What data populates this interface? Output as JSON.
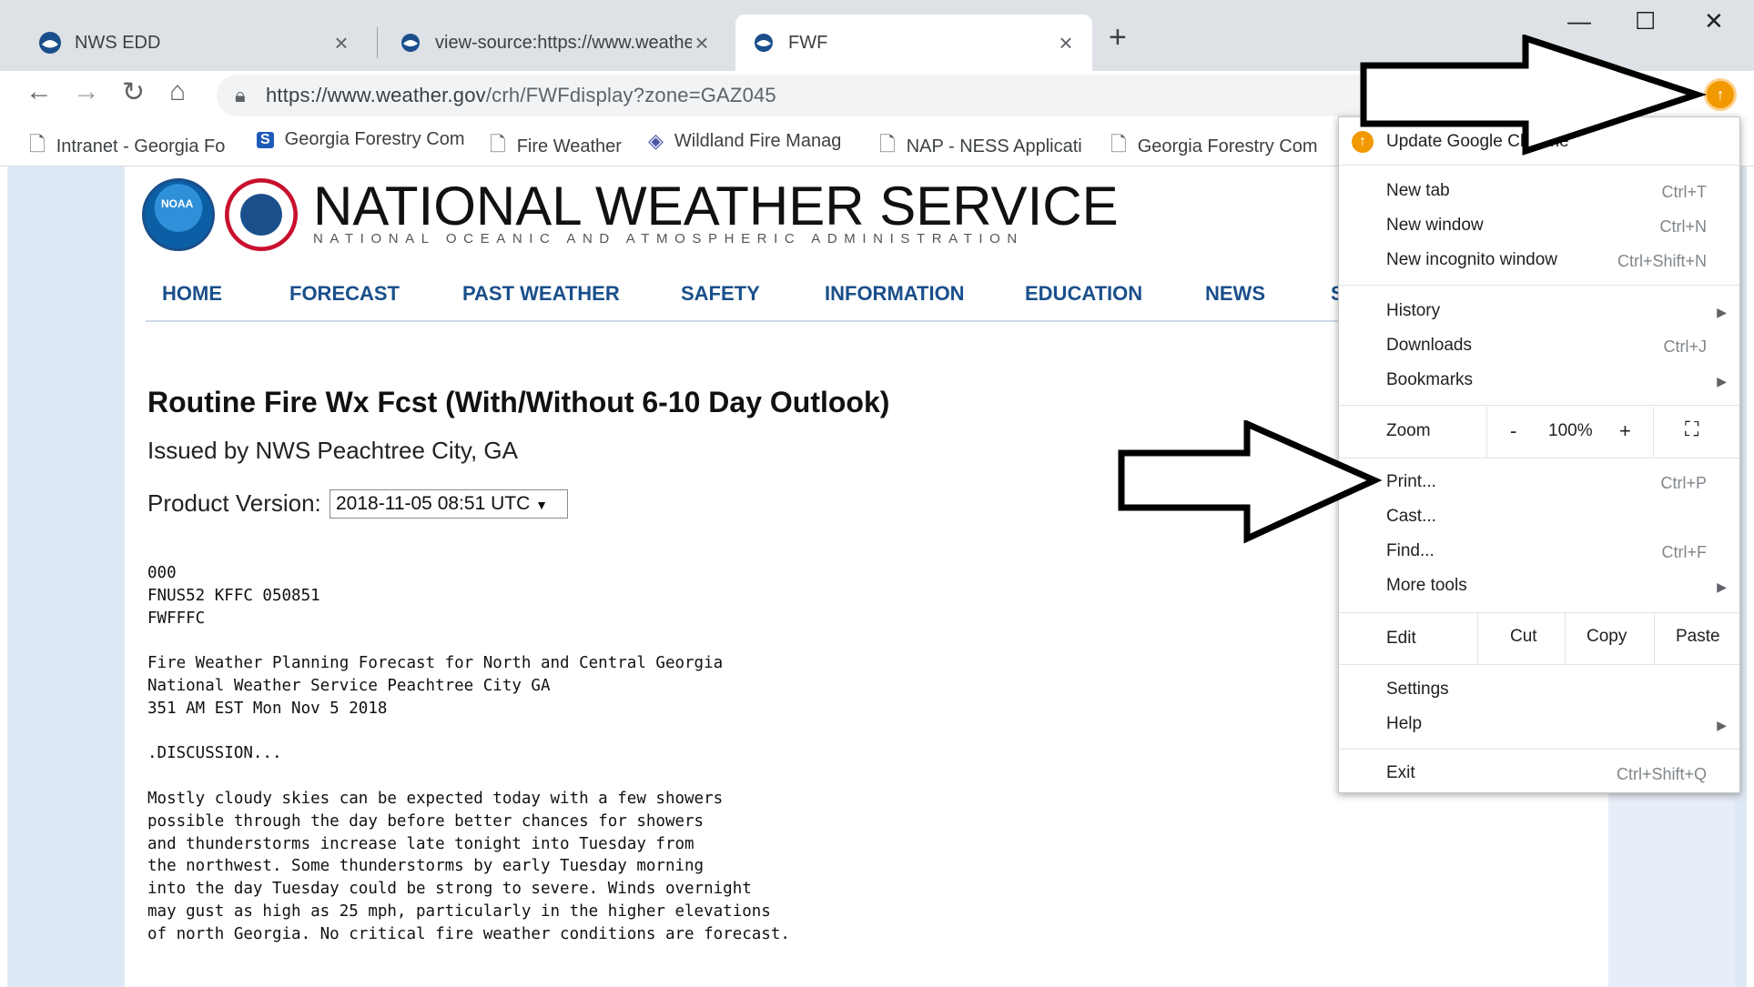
{
  "tabs": [
    {
      "title": "NWS EDD",
      "active": false
    },
    {
      "title": "view-source:https://www.weathe",
      "active": false
    },
    {
      "title": "FWF",
      "active": true
    }
  ],
  "window_controls": {
    "minimize": "—",
    "maximize": "☐",
    "close": "✕"
  },
  "toolbar": {
    "url_host": "https://www.weather.gov",
    "url_path": "/crh/FWFdisplay?zone=GAZ045"
  },
  "bookmarks": [
    {
      "label": "Intranet - Georgia Fo",
      "icon": "page-icon"
    },
    {
      "label": "Georgia Forestry Com",
      "icon": "sharepoint-icon"
    },
    {
      "label": "Fire Weather",
      "icon": "page-icon"
    },
    {
      "label": "Wildland Fire Manag",
      "icon": "diamond-icon"
    },
    {
      "label": "NAP - NESS Applicati",
      "icon": "page-icon"
    },
    {
      "label": "Georgia Forestry Com",
      "icon": "page-icon"
    }
  ],
  "site": {
    "title": "NATIONAL WEATHER SERVICE",
    "subtitle": "NATIONAL OCEANIC AND ATMOSPHERIC ADMINISTRATION",
    "logo_text": "NOAA",
    "nav": [
      "HOME",
      "FORECAST",
      "PAST WEATHER",
      "SAFETY",
      "INFORMATION",
      "EDUCATION",
      "NEWS",
      "S"
    ]
  },
  "product": {
    "heading": "Routine Fire Wx Fcst (With/Without 6-10 Day Outlook)",
    "issued_by": "Issued by NWS Peachtree City, GA",
    "version_label": "Product Version:",
    "version_value": "2018-11-05 08:51 UTC",
    "text": "000\nFNUS52 KFFC 050851\nFWFFFC\n\nFire Weather Planning Forecast for North and Central Georgia\nNational Weather Service Peachtree City GA\n351 AM EST Mon Nov 5 2018\n\n.DISCUSSION...\n\nMostly cloudy skies can be expected today with a few showers\npossible through the day before better chances for showers\nand thunderstorms increase late tonight into Tuesday from\nthe northwest. Some thunderstorms by early Tuesday morning\ninto the day Tuesday could be strong to severe. Winds overnight\nmay gust as high as 25 mph, particularly in the higher elevations\nof north Georgia. No critical fire weather conditions are forecast."
  },
  "menu": {
    "update": "Update Google Chrome",
    "new_tab": "New tab",
    "new_tab_sc": "Ctrl+T",
    "new_window": "New window",
    "new_window_sc": "Ctrl+N",
    "new_incognito": "New incognito window",
    "new_incognito_sc": "Ctrl+Shift+N",
    "history": "History",
    "downloads": "Downloads",
    "downloads_sc": "Ctrl+J",
    "bookmarks": "Bookmarks",
    "zoom": "Zoom",
    "zoom_minus": "-",
    "zoom_value": "100%",
    "zoom_plus": "+",
    "print": "Print...",
    "print_sc": "Ctrl+P",
    "cast": "Cast...",
    "find": "Find...",
    "find_sc": "Ctrl+F",
    "more_tools": "More tools",
    "edit": "Edit",
    "cut": "Cut",
    "copy": "Copy",
    "paste": "Paste",
    "settings": "Settings",
    "help": "Help",
    "exit": "Exit",
    "exit_sc": "Ctrl+Shift+Q"
  },
  "colors": {
    "nav_blue": "#1a4f8b",
    "update_orange": "#f29900"
  }
}
